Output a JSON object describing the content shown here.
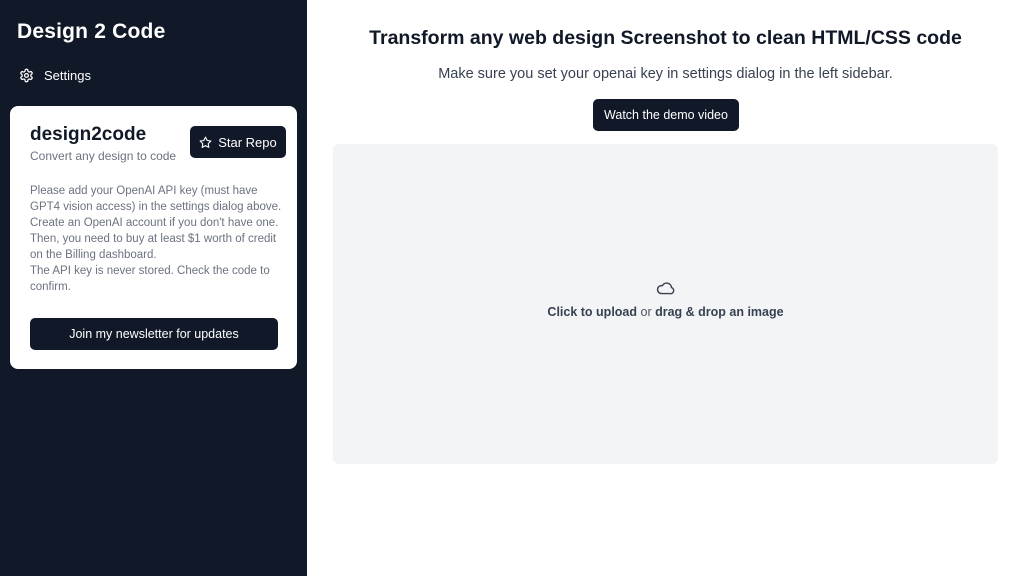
{
  "sidebar": {
    "app_title": "Design 2 Code",
    "settings_label": "Settings",
    "icons": {
      "settings": "gear-icon",
      "star": "star-icon"
    },
    "card": {
      "title": "design2code",
      "subtitle": "Convert any design to code",
      "star_button_label": "Star Repo",
      "paragraphs": [
        "Please add your OpenAI API key (must have GPT4 vision access) in the settings dialog above.",
        "Create an OpenAI account if you don't have one. Then, you need to buy at least $1 worth of credit on the Billing dashboard.",
        "The API key is never stored. Check the code to confirm."
      ],
      "newsletter_button_label": "Join my newsletter for updates"
    }
  },
  "main": {
    "title": "Transform any web design Screenshot to clean HTML/CSS code",
    "subtitle": "Make sure you set your openai key in settings dialog in the left sidebar.",
    "demo_button_label": "Watch the demo video",
    "dropzone": {
      "icon": "cloud-icon",
      "click_text": "Click to upload",
      "or_text": " or ",
      "drag_text": "drag & drop an image"
    }
  },
  "colors": {
    "sidebar_bg": "#111827",
    "button_bg": "#111827",
    "dropzone_bg": "#f3f4f6",
    "muted_text": "#6b7280"
  }
}
